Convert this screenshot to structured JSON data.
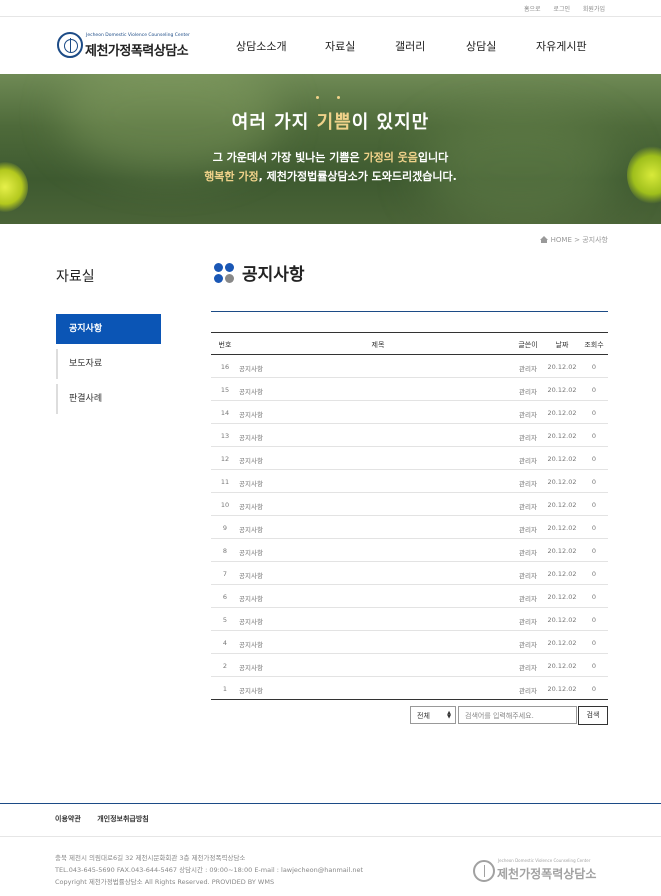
{
  "topbar": {
    "links": [
      "홈으로",
      "로그인",
      "회원가입"
    ]
  },
  "logo": {
    "en": "Jecheon Domestic Violence Counseling Center",
    "ko": "제천가정폭력상담소"
  },
  "gnb": [
    "상담소소개",
    "자료실",
    "갤러리",
    "상담실",
    "자유게시판"
  ],
  "banner": {
    "headline_a": "여러 가지 ",
    "headline_accent": "기쁨",
    "headline_b": "이 있지만",
    "line2_a": "그 가운데서 가장 빛나는 기쁨은 ",
    "line2_accent": "가정의 웃음",
    "line2_b": "입니다",
    "line3_accent": "행복한 가정",
    "line3_b": ", 제천가정법률상담소가 도와드리겠습니다."
  },
  "breadcrumb": {
    "home": "HOME",
    "sep": " > ",
    "current": "공지사항"
  },
  "sidebar": {
    "title": "자료실",
    "items": [
      "공지사항",
      "보도자료",
      "판결사례"
    ]
  },
  "content": {
    "title": "공지사항"
  },
  "board": {
    "headers": {
      "num": "번호",
      "title": "제목",
      "writer": "글쓴이",
      "date": "날짜",
      "views": "조회수"
    },
    "rows": [
      {
        "num": "16",
        "title": "공지사항",
        "writer": "관리자",
        "date": "20.12.02",
        "views": "0"
      },
      {
        "num": "15",
        "title": "공지사항",
        "writer": "관리자",
        "date": "20.12.02",
        "views": "0"
      },
      {
        "num": "14",
        "title": "공지사항",
        "writer": "관리자",
        "date": "20.12.02",
        "views": "0"
      },
      {
        "num": "13",
        "title": "공지사항",
        "writer": "관리자",
        "date": "20.12.02",
        "views": "0"
      },
      {
        "num": "12",
        "title": "공지사항",
        "writer": "관리자",
        "date": "20.12.02",
        "views": "0"
      },
      {
        "num": "11",
        "title": "공지사항",
        "writer": "관리자",
        "date": "20.12.02",
        "views": "0"
      },
      {
        "num": "10",
        "title": "공지사항",
        "writer": "관리자",
        "date": "20.12.02",
        "views": "0"
      },
      {
        "num": "9",
        "title": "공지사항",
        "writer": "관리자",
        "date": "20.12.02",
        "views": "0"
      },
      {
        "num": "8",
        "title": "공지사항",
        "writer": "관리자",
        "date": "20.12.02",
        "views": "0"
      },
      {
        "num": "7",
        "title": "공지사항",
        "writer": "관리자",
        "date": "20.12.02",
        "views": "0"
      },
      {
        "num": "6",
        "title": "공지사항",
        "writer": "관리자",
        "date": "20.12.02",
        "views": "0"
      },
      {
        "num": "5",
        "title": "공지사항",
        "writer": "관리자",
        "date": "20.12.02",
        "views": "0"
      },
      {
        "num": "4",
        "title": "공지사항",
        "writer": "관리자",
        "date": "20.12.02",
        "views": "0"
      },
      {
        "num": "2",
        "title": "공지사항",
        "writer": "관리자",
        "date": "20.12.02",
        "views": "0"
      },
      {
        "num": "1",
        "title": "공지사항",
        "writer": "관리자",
        "date": "20.12.02",
        "views": "0"
      }
    ]
  },
  "search": {
    "select_value": "전체",
    "placeholder": "검색어를 입력해주세요.",
    "button": "검색"
  },
  "footer": {
    "links": [
      "이용약관",
      "개인정보취급방침"
    ],
    "address": "충북 제천시 의림대로6길 32 제천시문화회관 3층 제천가정폭력상담소",
    "contact": "TEL.043-645-5690    FAX.043-644-5467   상담시간 : 09:00~18:00   E-mail : lawjecheon@hanmail.net",
    "copyright": "Copyright 제천가정법률상담소 All Rights Reserved. PROVIDED BY WMS",
    "logo_en": "Jecheon Domestic Violence Counseling Center",
    "logo_ko": "제천가정폭력상담소"
  }
}
